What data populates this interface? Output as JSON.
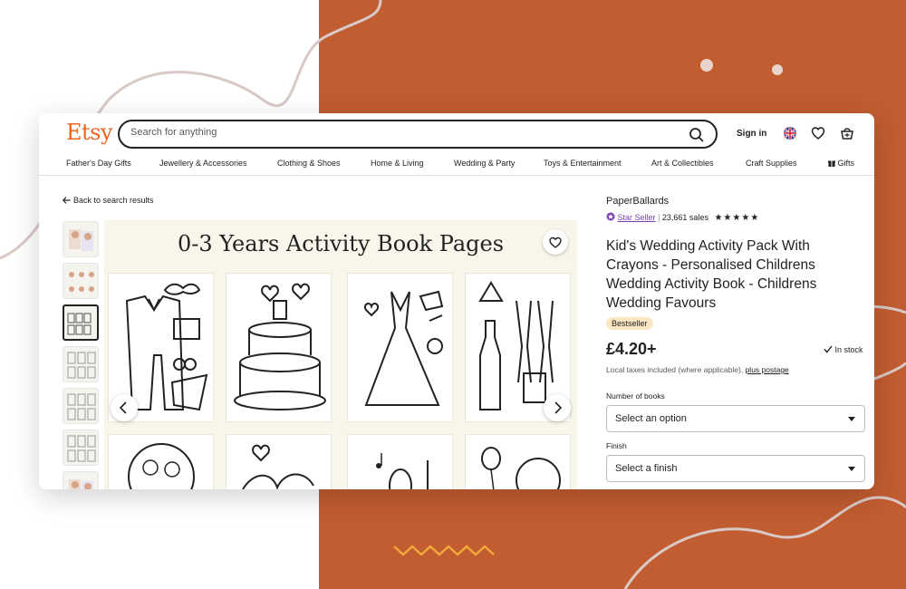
{
  "header": {
    "logo": "Etsy",
    "search_placeholder": "Search for anything",
    "signin": "Sign in"
  },
  "nav": [
    "Father's Day Gifts",
    "Jewellery & Accessories",
    "Clothing & Shoes",
    "Home & Living",
    "Wedding & Party",
    "Toys & Entertainment",
    "Art & Collectibles",
    "Craft Supplies",
    "Gifts"
  ],
  "back_link": "Back to search results",
  "gallery": {
    "image_title": "0-3 Years Activity Book Pages"
  },
  "product": {
    "shop_name": "PaperBallards",
    "star_seller": "Star Seller",
    "sales": "23,661 sales",
    "rating_stars": 5,
    "title": "Kid's Wedding Activity Pack With Crayons - Personalised Childrens Wedding Activity Book - Childrens Wedding Favours",
    "badge": "Bestseller",
    "price": "£4.20+",
    "stock": "In stock",
    "tax_text": "Local taxes included (where applicable),",
    "tax_link": "plus postage",
    "options": [
      {
        "label": "Number of books",
        "value": "Select an option"
      },
      {
        "label": "Finish",
        "value": "Select a finish"
      }
    ]
  },
  "colors": {
    "brand": "#f1641e",
    "background_accent": "#c25c31",
    "star_seller": "#7b3fb2",
    "badge": "#fbe6c2"
  },
  "icons": [
    "search-icon",
    "uk-flag-icon",
    "heart-icon",
    "cart-icon",
    "gift-icon",
    "arrow-left-icon",
    "chevron-left-icon",
    "chevron-right-icon",
    "check-icon",
    "star-seller-icon"
  ]
}
